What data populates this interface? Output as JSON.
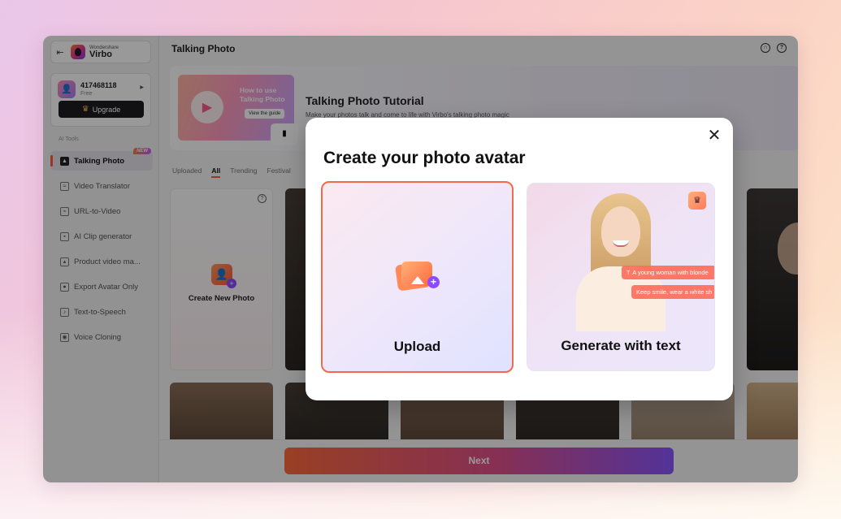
{
  "app": {
    "brand_small": "Wondershare",
    "brand_name": "Virbo",
    "page_title": "Talking Photo",
    "accent_color": "#ff5a3d"
  },
  "account": {
    "id": "417468118",
    "plan": "Free",
    "upgrade_label": "Upgrade"
  },
  "sidebar": {
    "section_title": "AI Tools",
    "new_badge": "NEW",
    "items": [
      {
        "label": "Talking Photo",
        "icon": "photo-icon"
      },
      {
        "label": "Video Translator",
        "icon": "translate-icon"
      },
      {
        "label": "URL-to-Video",
        "icon": "url-icon"
      },
      {
        "label": "AI Clip generator",
        "icon": "clip-icon"
      },
      {
        "label": "Product video ma...",
        "icon": "product-icon"
      },
      {
        "label": "Export Avatar Only",
        "icon": "avatar-icon"
      },
      {
        "label": "Text-to-Speech",
        "icon": "speech-icon"
      },
      {
        "label": "Voice Cloning",
        "icon": "voice-icon"
      }
    ]
  },
  "banner": {
    "thumb_text": "How to use Talking Photo",
    "thumb_guide": "View the guide",
    "title": "Talking Photo Tutorial",
    "subtitle": "Make your photos talk and come to life with Virbo's talking photo magic"
  },
  "filters": {
    "tabs": [
      "Uploaded",
      "All",
      "Trending",
      "Festival"
    ]
  },
  "grid": {
    "create_label": "Create New Photo"
  },
  "footer": {
    "next_label": "Next"
  },
  "modal": {
    "title": "Create your photo avatar",
    "upload_label": "Upload",
    "generate_label": "Generate with text",
    "chip1": "A young woman with blonde",
    "chip2": "Keep smile, wear a white sh"
  }
}
